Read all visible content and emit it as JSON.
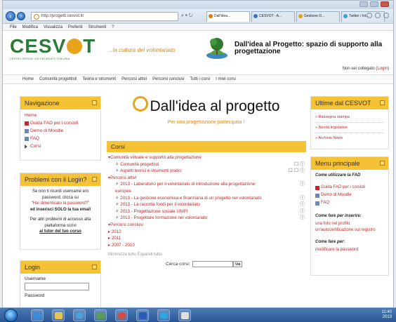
{
  "browser": {
    "address": "http://progetti.cesvot.it/",
    "addr_tools": "⌕ ▾ ↻",
    "tabs": [
      {
        "label": "Dall'idea...",
        "active": true,
        "color": "#e07b1c"
      },
      {
        "label": "CESVOT - A...",
        "active": false,
        "color": "#3a78c9"
      },
      {
        "label": "Gestione D...",
        "active": false,
        "color": "#e0a31c"
      },
      {
        "label": "Twitter / Int...",
        "active": false,
        "color": "#3aa0e0"
      }
    ],
    "menu": [
      "File",
      "Modifica",
      "Visualizza",
      "Preferiti",
      "Strumenti",
      "?"
    ]
  },
  "header": {
    "logo_text_left": "CESV",
    "logo_text_right": "T",
    "logo_subtitle": "CENTRO SERVIZI VOLONTARIATO TOSCANA",
    "tagline": "...la cultura del volontariato",
    "site_title": "Dall'idea al Progetto: spazio di supporto alla progettazione",
    "login_status": "Non sei collegato (",
    "login_link": "Login",
    "login_close": ")"
  },
  "navbar": [
    "Home",
    "Comunità progettisti",
    "Teoria e strumenti",
    "Percorsi attivi",
    "Percorsi conclusi",
    "Tutti i corsi",
    "I miei corsi"
  ],
  "navigation": {
    "title": "Navigazione",
    "home": "Home",
    "items": [
      "Guida FAD per i corsisti",
      "Demo di Moodle",
      "FAQ",
      "Corsi"
    ]
  },
  "login_problems": {
    "title": "Problemi con il Login?",
    "line1": "Se non ti ricordi username e/o password, clicca su",
    "link1": "\"Hai dimenticato la password?\"",
    "line2": "ed inserisci SOLO la tua email",
    "line3": "Per altri problemi di accesso alla piattaforma scrivi",
    "link2": "al tutor del tuo corso"
  },
  "login_block": {
    "title": "Login",
    "username_label": "Username",
    "password_label": "Password"
  },
  "center": {
    "title": "Dall'idea al progetto",
    "subtitle": "Per una progettazione partecipata !",
    "corsi_title": "Corsi",
    "rows": [
      {
        "text": "▾Comunità virtuale e supporto alla progettazione",
        "level": "l1",
        "side": ""
      },
      {
        "text": "Comunità progettisti",
        "level": "l2",
        "side": "☐ ⓘ"
      },
      {
        "text": "Aspetti teorici e strumenti pratici",
        "level": "l2",
        "side": "☐ ☐ ⓘ"
      },
      {
        "text": "▾Percorsi attivi",
        "level": "l1",
        "side": ""
      },
      {
        "text": "2013 - Laboratorio per il volontariato di introduzione alla progettazione",
        "level": "l2",
        "side": "ⓘ"
      },
      {
        "text": "europea",
        "level": "l3",
        "side": ""
      },
      {
        "text": "2013 - La gestione economica e finanziaria di un progetto nel volontariato",
        "level": "l2",
        "side": "ⓘ"
      },
      {
        "text": "2013 - La raccolta fondi per il volontariato",
        "level": "l2",
        "side": "ⓘ"
      },
      {
        "text": "2013 - Progettazione sociale UNIFI",
        "level": "l2",
        "side": "ⓘ"
      },
      {
        "text": "2013 - Progettare formazione nel volontariato",
        "level": "l2",
        "side": "ⓘ"
      },
      {
        "text": "▾Percorsi conclusi",
        "level": "l1",
        "side": ""
      },
      {
        "text": "▸ 2012",
        "level": "l1",
        "side": ""
      },
      {
        "text": "▸ 2011",
        "level": "l1",
        "side": ""
      },
      {
        "text": "▸ 2007 - 2010",
        "level": "l1",
        "side": ""
      }
    ],
    "expand_collapse": "Minimizza tutto  Espandi tutto",
    "search_label": "Cerca corsi:",
    "search_button": "Vai"
  },
  "news": {
    "title": "Ultime dal CESVOT",
    "items": [
      "» Rassegna stampa",
      "» Novità legislative",
      "» Archivio News"
    ]
  },
  "main_menu": {
    "title": "Menu principale",
    "intro": "Come utilizzare la FAD",
    "items": [
      "Guida FAD per i corsisti",
      "Demo di Moodle",
      "FAQ"
    ],
    "enroll_heading": "Come fare per inserire:",
    "enroll_text": "una foto nel profilo un'autocertificazione sul registro",
    "pwd_heading": "Come fare per:",
    "pwd_text": "modificare la password"
  },
  "taskbar": {
    "time": "11:40",
    "date": "2013"
  }
}
